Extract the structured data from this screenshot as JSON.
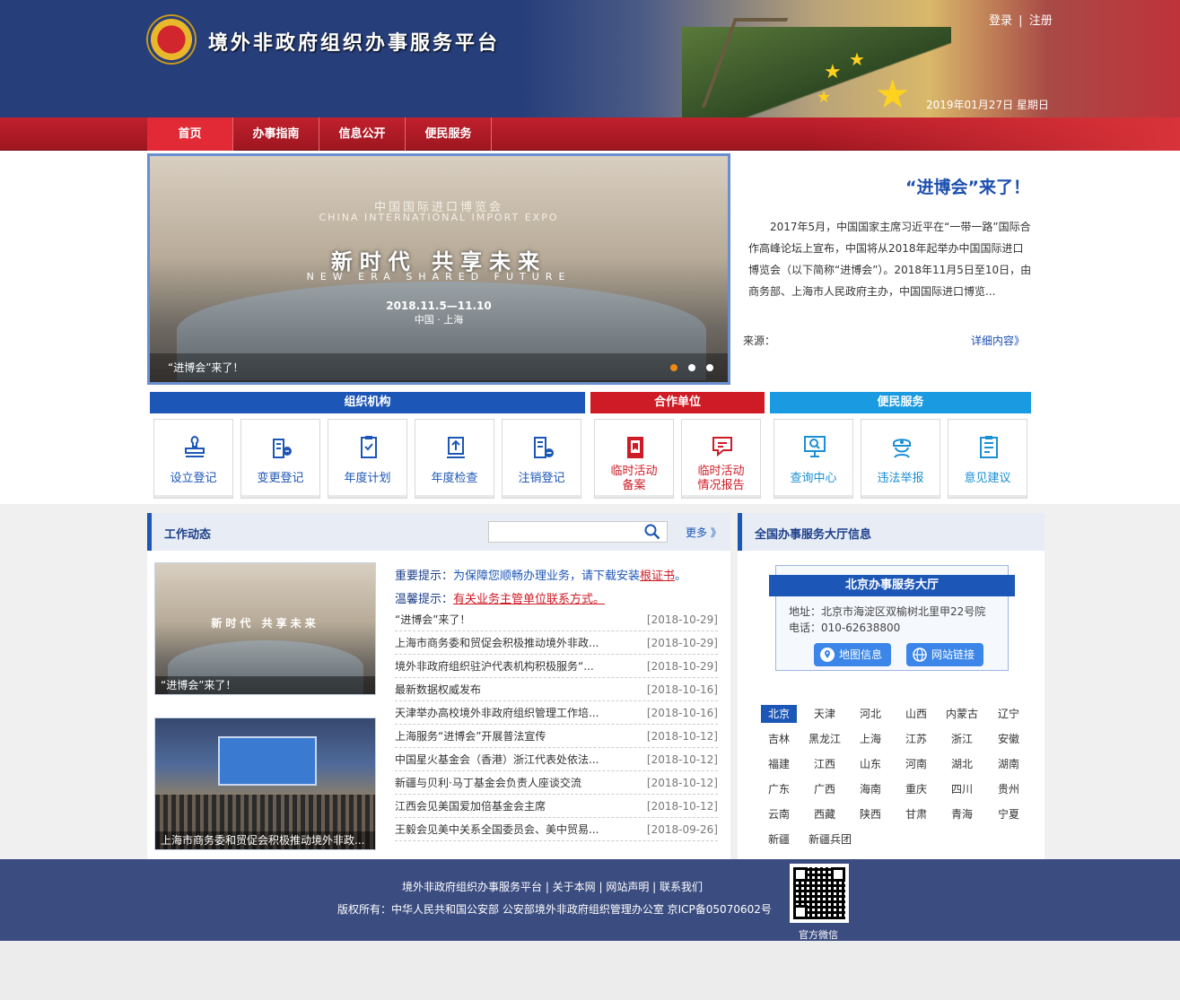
{
  "header": {
    "site_title": "境外非政府组织办事服务平台",
    "login": "登录",
    "separator": "|",
    "register": "注册",
    "date": "2019年01月27日 星期日"
  },
  "nav": {
    "items": [
      "首页",
      "办事指南",
      "信息公开",
      "便民服务"
    ],
    "active": "首页"
  },
  "hero": {
    "slide_expo_cn": "中国国际进口博览会",
    "slide_expo_en": "CHINA INTERNATIONAL IMPORT EXPO",
    "slide_slogan": "新时代  共享未来",
    "slide_slogan_en": "NEW ERA SHARED FUTURE",
    "slide_dates": "2018.11.5—11.10",
    "slide_place": "中国 · 上海",
    "caption": "“进博会”来了！",
    "title": "“进博会”来了！",
    "body": "2017年5月，中国国家主席习近平在“一带一路”国际合作高峰论坛上宣布，中国将从2018年起举办中国国际进口博览会（以下简称“进博会”）。2018年11月5日至10日，由商务部、上海市人民政府主办，中国国际进口博览...",
    "source": "来源：",
    "more": "详细内容》",
    "active_dot": 0,
    "dot_count": 3
  },
  "services": {
    "categories": {
      "org": "组织机构",
      "coop": "合作单位",
      "conv": "便民服务"
    },
    "items": [
      {
        "label": "设立登记",
        "icon": "register-stamp-icon",
        "group": "org"
      },
      {
        "label": "变更登记",
        "icon": "change-building-icon",
        "group": "org"
      },
      {
        "label": "年度计划",
        "icon": "plan-document-icon",
        "group": "org"
      },
      {
        "label": "年度检查",
        "icon": "inspection-upload-icon",
        "group": "org"
      },
      {
        "label": "注销登记",
        "icon": "cancel-building-icon",
        "group": "org"
      },
      {
        "label": "临时活动\n备案",
        "icon": "activity-record-icon",
        "group": "coop"
      },
      {
        "label": "临时活动\n情况报告",
        "icon": "activity-report-icon",
        "group": "coop"
      },
      {
        "label": "查询中心",
        "icon": "query-monitor-icon",
        "group": "conv"
      },
      {
        "label": "违法举报",
        "icon": "police-report-icon",
        "group": "conv"
      },
      {
        "label": "意见建议",
        "icon": "feedback-form-icon",
        "group": "conv"
      }
    ]
  },
  "news": {
    "title": "工作动态",
    "search_placeholder": "",
    "more": "更多 》",
    "thumb1_slogan": "新时代 共享未来",
    "thumb1_caption": "“进博会”来了！",
    "thumb2_caption": "上海市商务委和贸促会积极推动境外非政...",
    "notice1_lead": "重要提示：",
    "notice1_msg": "为保障您顺畅办理业务，请下载安装",
    "notice1_link": "根证书",
    "notice1_end": "。",
    "notice2_lead": "温馨提示：",
    "notice2_link": "有关业务主管单位联系方式。",
    "items": [
      {
        "title": "“进博会”来了！",
        "date": "[2018-10-29]"
      },
      {
        "title": "上海市商务委和贸促会积极推动境外非政...",
        "date": "[2018-10-29]"
      },
      {
        "title": "境外非政府组织驻沪代表机构积极服务“...",
        "date": "[2018-10-29]"
      },
      {
        "title": "最新数据权威发布",
        "date": "[2018-10-16]"
      },
      {
        "title": "天津举办高校境外非政府组织管理工作培...",
        "date": "[2018-10-16]"
      },
      {
        "title": "上海服务“进博会”开展普法宣传",
        "date": "[2018-10-12]"
      },
      {
        "title": "中国星火基金会（香港）浙江代表处依法...",
        "date": "[2018-10-12]"
      },
      {
        "title": "新疆与贝利·马丁基金会负责人座谈交流",
        "date": "[2018-10-12]"
      },
      {
        "title": "江西会见美国爱加倍基金会主席",
        "date": "[2018-10-12]"
      },
      {
        "title": "王毅会见美中关系全国委员会、美中贸易...",
        "date": "[2018-09-26]"
      }
    ]
  },
  "hall": {
    "title": "全国办事服务大厅信息",
    "card_title": "北京办事服务大厅",
    "address": "地址：北京市海淀区双榆树北里甲22号院",
    "phone": "电话：010-62638800",
    "map_btn": "地图信息",
    "site_btn": "网站链接",
    "selected": "北京",
    "provinces": [
      "北京",
      "天津",
      "河北",
      "山西",
      "内蒙古",
      "辽宁",
      "吉林",
      "黑龙江",
      "上海",
      "江苏",
      "浙江",
      "安徽",
      "福建",
      "江西",
      "山东",
      "河南",
      "湖北",
      "湖南",
      "广东",
      "广西",
      "海南",
      "重庆",
      "四川",
      "贵州",
      "云南",
      "西藏",
      "陕西",
      "甘肃",
      "青海",
      "宁夏",
      "新疆",
      "新疆兵团"
    ]
  },
  "footer": {
    "line1": "境外非政府组织办事服务平台 | 关于本网 | 网站声明 | 联系我们",
    "line2": "版权所有：中华人民共和国公安部 公安部境外非政府组织管理办公室 京ICP备05070602号",
    "qr_label": "官方微信"
  },
  "colors": {
    "header_bg": "#263e7a",
    "nav_red": "#c0202c",
    "brand_blue": "#1c56b6",
    "coop_red": "#cf1b26",
    "conv_cyan": "#1a9ae0",
    "footer_bg": "#3b4c80",
    "active_dot": "#f08a12"
  }
}
